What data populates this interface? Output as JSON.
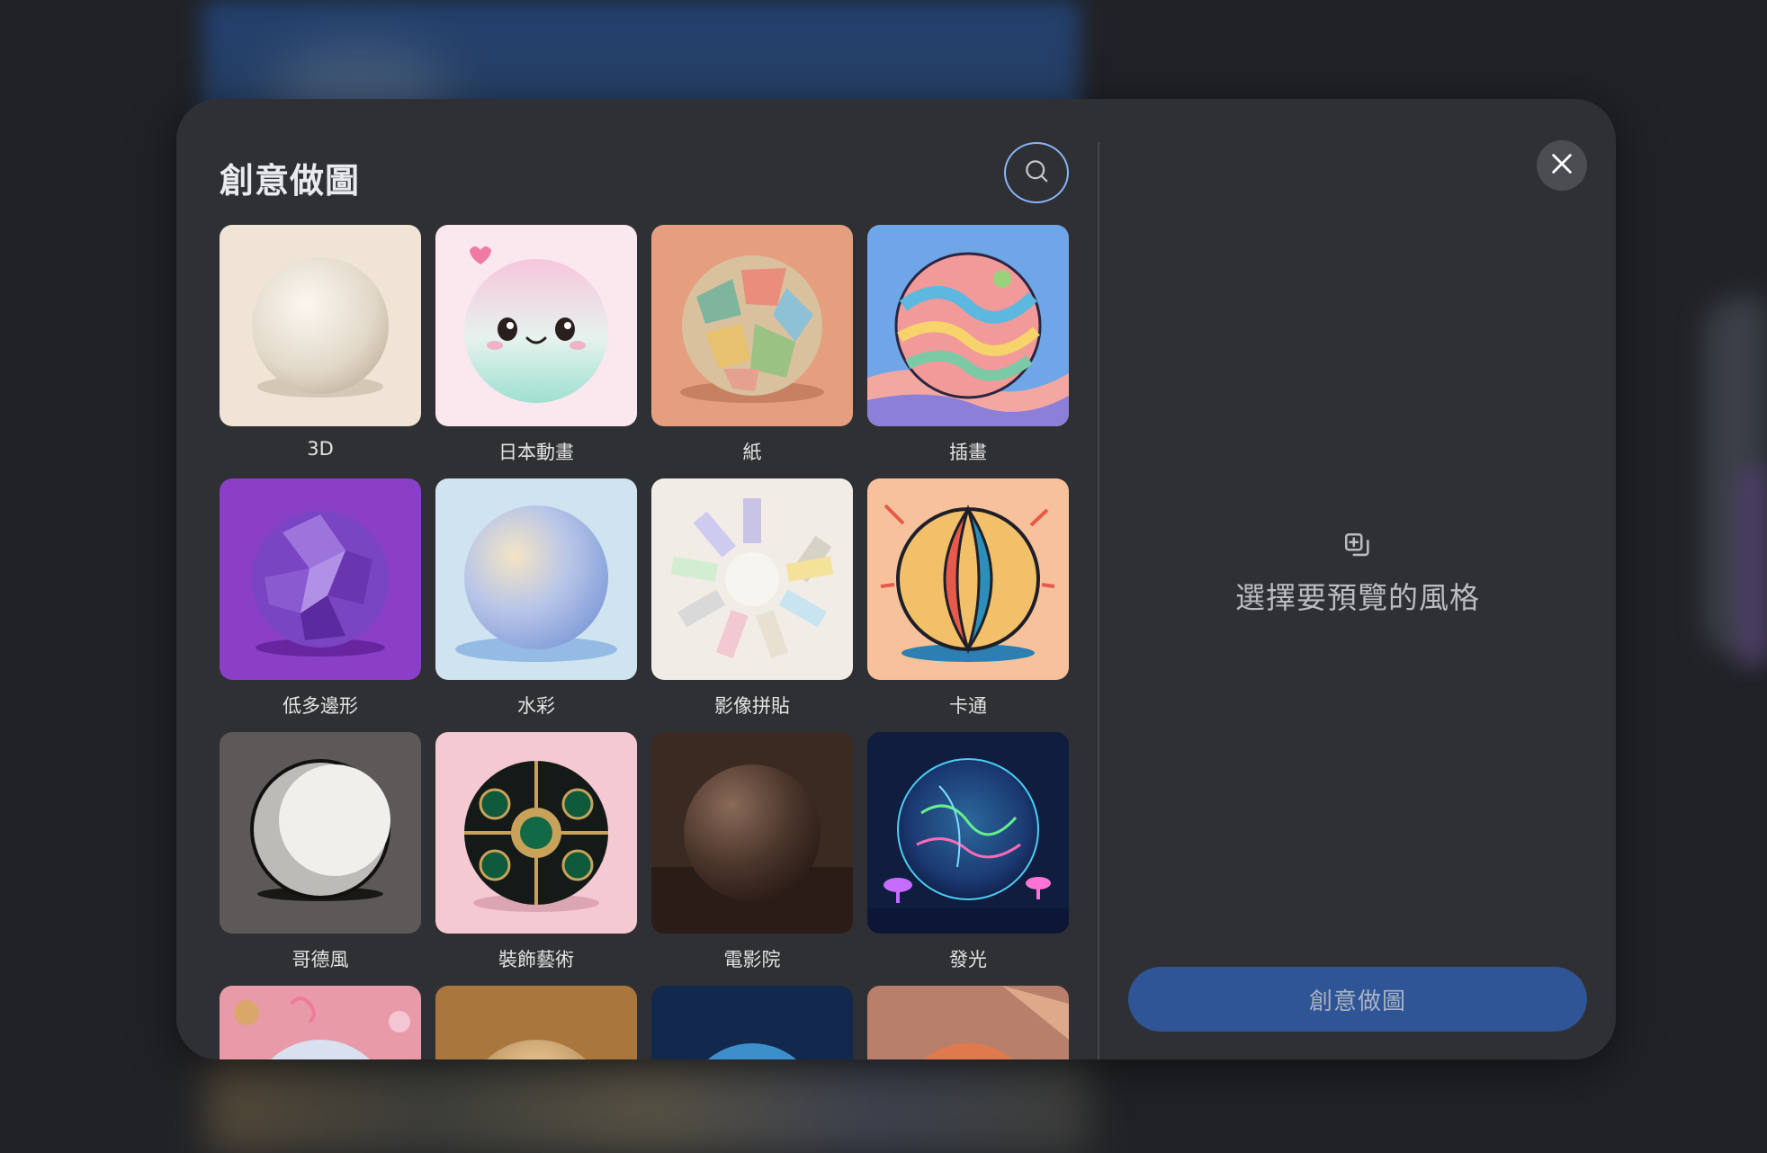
{
  "dialog": {
    "title": "創意做圖",
    "styles": [
      {
        "label": "3D"
      },
      {
        "label": "日本動畫"
      },
      {
        "label": "紙"
      },
      {
        "label": "插畫"
      },
      {
        "label": "低多邊形"
      },
      {
        "label": "水彩"
      },
      {
        "label": "影像拼貼"
      },
      {
        "label": "卡通"
      },
      {
        "label": "哥德風"
      },
      {
        "label": "裝飾藝術"
      },
      {
        "label": "電影院"
      },
      {
        "label": "發光"
      }
    ],
    "preview": {
      "placeholder_text": "選擇要預覽的風格",
      "icon": "style-preview-icon"
    },
    "create_button_label": "創意做圖"
  },
  "colors": {
    "dialog_bg": "#2f3034",
    "accent_blue": "#8ab4f8",
    "button_bg": "#2f5596"
  },
  "icons": {
    "search": "search-icon",
    "close": "close-icon"
  }
}
